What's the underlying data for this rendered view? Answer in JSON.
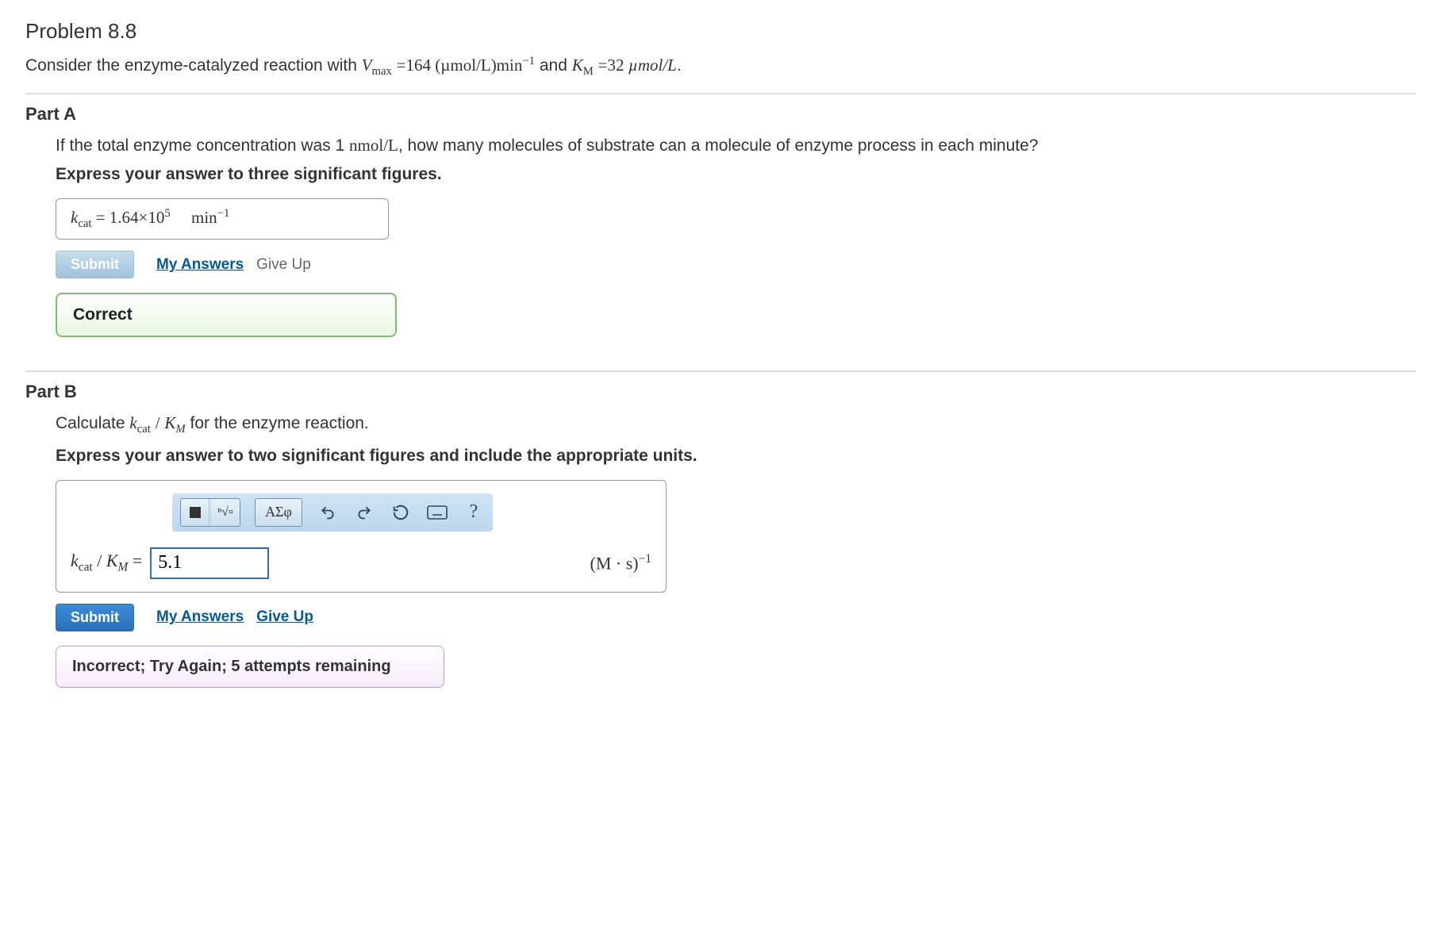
{
  "problem": {
    "title": "Problem 8.8",
    "stem_prefix": "Consider the enzyme-catalyzed reaction with ",
    "vmax_expr": "V",
    "vmax_sub": "max",
    "vmax_eq": "=164 ",
    "vmax_units": "(µmol/L)min",
    "vmax_exp": "−1",
    "and_word": " and ",
    "km_sym": "K",
    "km_sub": "M",
    "km_eq": "=32 ",
    "km_units": "µmol/L",
    "stem_end": "."
  },
  "partA": {
    "title": "Part A",
    "question_prefix": "If the total enzyme concentration was 1 ",
    "conc_math": "nmol/L",
    "question_suffix": ", how many molecules of substrate can a molecule of enzyme process in each minute?",
    "instruction": "Express your answer to three significant figures.",
    "ans_sym": "k",
    "ans_sub": "cat",
    "ans_eq": " = ",
    "ans_value": "1.64×10",
    "ans_exp": "5",
    "ans_unit_gap": "   ",
    "ans_unit": "min",
    "ans_unit_exp": "−1",
    "submit": "Submit",
    "my_answers": "My Answers",
    "give_up": "Give Up",
    "feedback": "Correct"
  },
  "partB": {
    "title": "Part B",
    "question_prefix": "Calculate ",
    "q_sym1": "k",
    "q_sub1": "cat",
    "q_slash": "/",
    "q_sym2": "K",
    "q_sub2": "M",
    "question_suffix": " for the enzyme reaction.",
    "instruction": "Express your answer to two significant figures and include the appropriate units.",
    "tool_templates_label": "templates",
    "tool_symbols_label": "ΑΣφ",
    "entry_sym1": "k",
    "entry_sub1": "cat",
    "entry_sym2": "K",
    "entry_sub2": "M",
    "entry_eq": " = ",
    "input_value": "5.1",
    "units_open": "(M · s)",
    "units_exp": "−1",
    "submit": "Submit",
    "my_answers": "My Answers",
    "give_up": "Give Up",
    "feedback": "Incorrect; Try Again; 5 attempts remaining"
  }
}
